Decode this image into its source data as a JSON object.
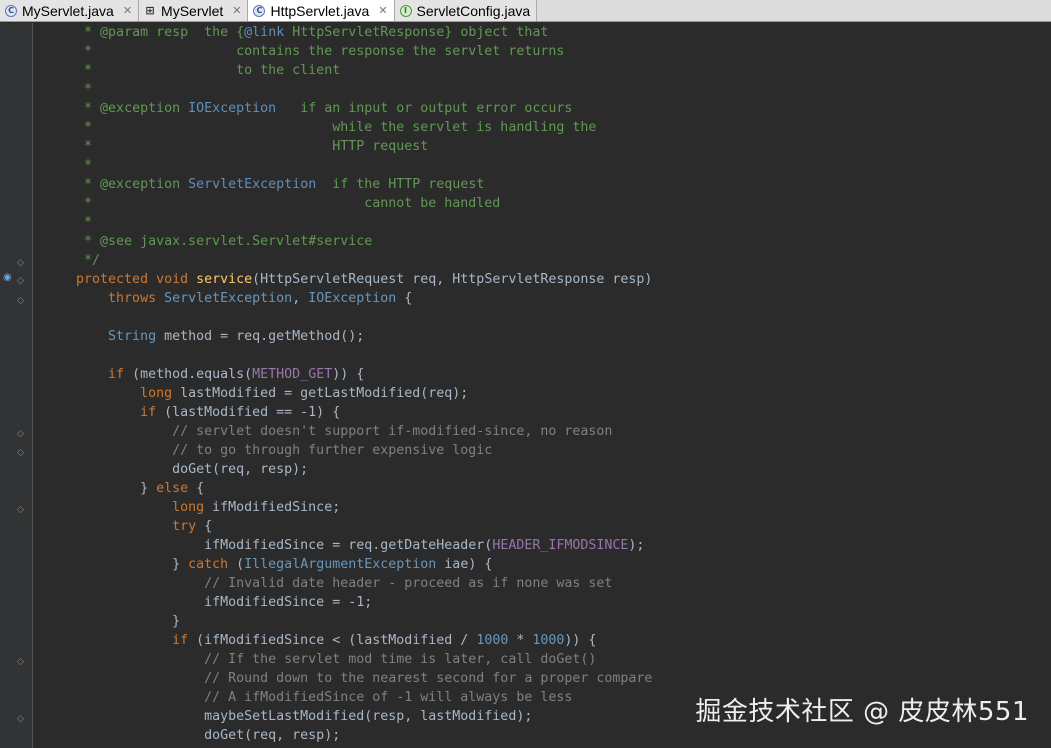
{
  "tabs": [
    {
      "label": "MyServlet.java",
      "icon": "class-icon",
      "closable": true,
      "active": false
    },
    {
      "label": "MyServlet",
      "icon": "structure-icon",
      "closable": true,
      "active": false
    },
    {
      "label": "HttpServlet.java",
      "icon": "abstract-class-icon",
      "closable": true,
      "active": true
    },
    {
      "label": "ServletConfig.java",
      "icon": "interface-icon",
      "closable": false,
      "active": false
    }
  ],
  "code_lines": [
    [
      [
        "doc",
        "     * "
      ],
      [
        "dtag",
        "@param"
      ],
      [
        "doc",
        " resp  the {"
      ],
      [
        "dref",
        "@link"
      ],
      [
        "doc",
        " HttpServletResponse} object that"
      ]
    ],
    [
      [
        "doc",
        "     *                  contains the response the servlet returns"
      ]
    ],
    [
      [
        "doc",
        "     *                  to the client"
      ]
    ],
    [
      [
        "doc",
        "     *"
      ]
    ],
    [
      [
        "doc",
        "     * "
      ],
      [
        "dtag",
        "@exception"
      ],
      [
        "doc",
        " "
      ],
      [
        "dref",
        "IOException"
      ],
      [
        "doc",
        "   if an input or output error occurs"
      ]
    ],
    [
      [
        "doc",
        "     *                              while the servlet is handling the"
      ]
    ],
    [
      [
        "doc",
        "     *                              HTTP request"
      ]
    ],
    [
      [
        "doc",
        "     *"
      ]
    ],
    [
      [
        "doc",
        "     * "
      ],
      [
        "dtag",
        "@exception"
      ],
      [
        "doc",
        " "
      ],
      [
        "dref",
        "ServletException"
      ],
      [
        "doc",
        "  if the HTTP request"
      ]
    ],
    [
      [
        "doc",
        "     *                                  cannot be handled"
      ]
    ],
    [
      [
        "doc",
        "     *"
      ]
    ],
    [
      [
        "doc",
        "     * "
      ],
      [
        "dtag",
        "@see"
      ],
      [
        "doc",
        " javax.servlet.Servlet#service"
      ]
    ],
    [
      [
        "doc",
        "     */"
      ]
    ],
    [
      [
        "kw",
        "    protected void "
      ],
      [
        "fn",
        "service"
      ],
      [
        "pl",
        "(HttpServletRequest req, HttpServletResponse resp)"
      ]
    ],
    [
      [
        "kw",
        "        throws "
      ],
      [
        "cls",
        "ServletException"
      ],
      [
        "pl",
        ", "
      ],
      [
        "cls",
        "IOException"
      ],
      [
        "pl",
        " {"
      ]
    ],
    [
      [
        "pl",
        ""
      ]
    ],
    [
      [
        "cls",
        "        String"
      ],
      [
        "pl",
        " method = req.getMethod();"
      ]
    ],
    [
      [
        "pl",
        ""
      ]
    ],
    [
      [
        "kw",
        "        if"
      ],
      [
        "pl",
        " (method.equals("
      ],
      [
        "cst",
        "METHOD_GET"
      ],
      [
        "pl",
        ")) {"
      ]
    ],
    [
      [
        "kw",
        "            long"
      ],
      [
        "pl",
        " lastModified = getLastModified(req);"
      ]
    ],
    [
      [
        "kw",
        "            if"
      ],
      [
        "pl",
        " (lastModified == -1) {"
      ]
    ],
    [
      [
        "cmt",
        "                // servlet doesn't support if-modified-since, no reason"
      ]
    ],
    [
      [
        "cmt",
        "                // to go through further expensive logic"
      ]
    ],
    [
      [
        "pl",
        "                doGet(req, resp);"
      ]
    ],
    [
      [
        "pl",
        "            } "
      ],
      [
        "kw",
        "else"
      ],
      [
        "pl",
        " {"
      ]
    ],
    [
      [
        "kw",
        "                long"
      ],
      [
        "pl",
        " ifModifiedSince;"
      ]
    ],
    [
      [
        "kw",
        "                try"
      ],
      [
        "pl",
        " {"
      ]
    ],
    [
      [
        "pl",
        "                    ifModifiedSince = req.getDateHeader("
      ],
      [
        "cst",
        "HEADER_IFMODSINCE"
      ],
      [
        "pl",
        ");"
      ]
    ],
    [
      [
        "pl",
        "                } "
      ],
      [
        "kw",
        "catch"
      ],
      [
        "pl",
        " ("
      ],
      [
        "cls",
        "IllegalArgumentException"
      ],
      [
        "pl",
        " iae) {"
      ]
    ],
    [
      [
        "cmt",
        "                    // Invalid date header - proceed as if none was set"
      ]
    ],
    [
      [
        "pl",
        "                    ifModifiedSince = -1;"
      ]
    ],
    [
      [
        "pl",
        "                }"
      ]
    ],
    [
      [
        "kw",
        "                if"
      ],
      [
        "pl",
        " (ifModifiedSince < (lastModified / "
      ],
      [
        "num",
        "1000"
      ],
      [
        "pl",
        " * "
      ],
      [
        "num",
        "1000"
      ],
      [
        "pl",
        ")) {"
      ]
    ],
    [
      [
        "cmt",
        "                    // If the servlet mod time is later, call doGet()"
      ]
    ],
    [
      [
        "cmt",
        "                    // Round down to the nearest second for a proper compare"
      ]
    ],
    [
      [
        "cmt",
        "                    // A ifModifiedSince of -1 will always be less"
      ]
    ],
    [
      [
        "pl",
        "                    maybeSetLastModified(resp, lastModified);"
      ]
    ],
    [
      [
        "pl",
        "                    doGet(req, resp);"
      ]
    ]
  ],
  "watermark": "掘金技术社区 @ 皮皮林551"
}
